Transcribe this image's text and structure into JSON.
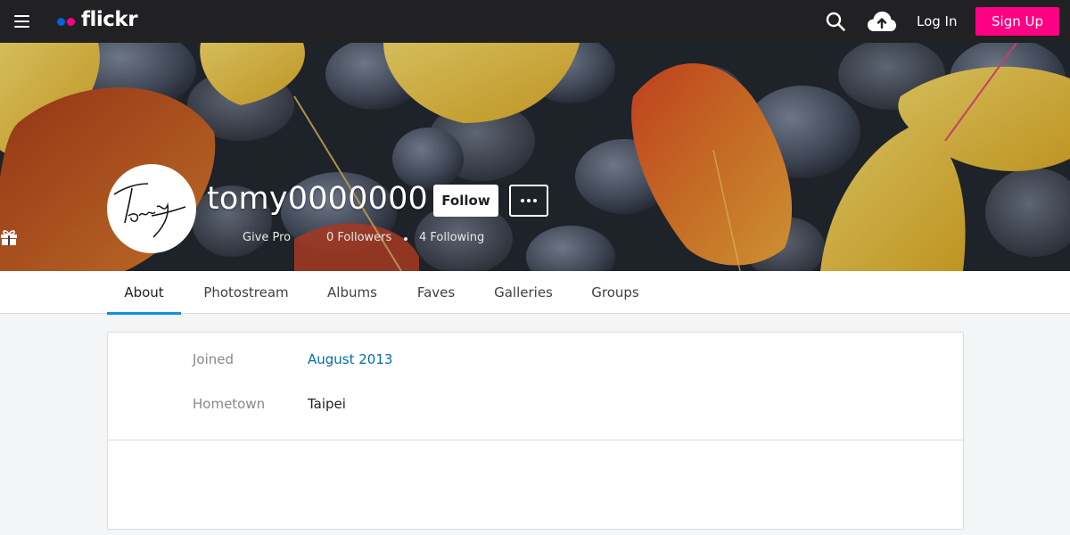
{
  "nav": {
    "logo_text": "flickr",
    "login_label": "Log In",
    "signup_label": "Sign Up",
    "colors": {
      "bar": "#212124",
      "brand_blue": "#0063dc",
      "brand_pink": "#ff0084"
    }
  },
  "profile": {
    "username": "tomy0000000",
    "follow_label": "Follow",
    "give_pro_label": "Give Pro",
    "followers_label": "0 Followers",
    "following_label": "4 Following"
  },
  "tabs": [
    {
      "label": "About",
      "active": true
    },
    {
      "label": "Photostream"
    },
    {
      "label": "Albums"
    },
    {
      "label": "Faves"
    },
    {
      "label": "Galleries"
    },
    {
      "label": "Groups"
    }
  ],
  "about": {
    "joined_label": "Joined",
    "joined_value": "August 2013",
    "hometown_label": "Hometown",
    "hometown_value": "Taipei"
  },
  "icons": [
    "menu-icon",
    "search-icon",
    "upload-cloud-icon",
    "more-dots-icon",
    "gift-icon"
  ]
}
